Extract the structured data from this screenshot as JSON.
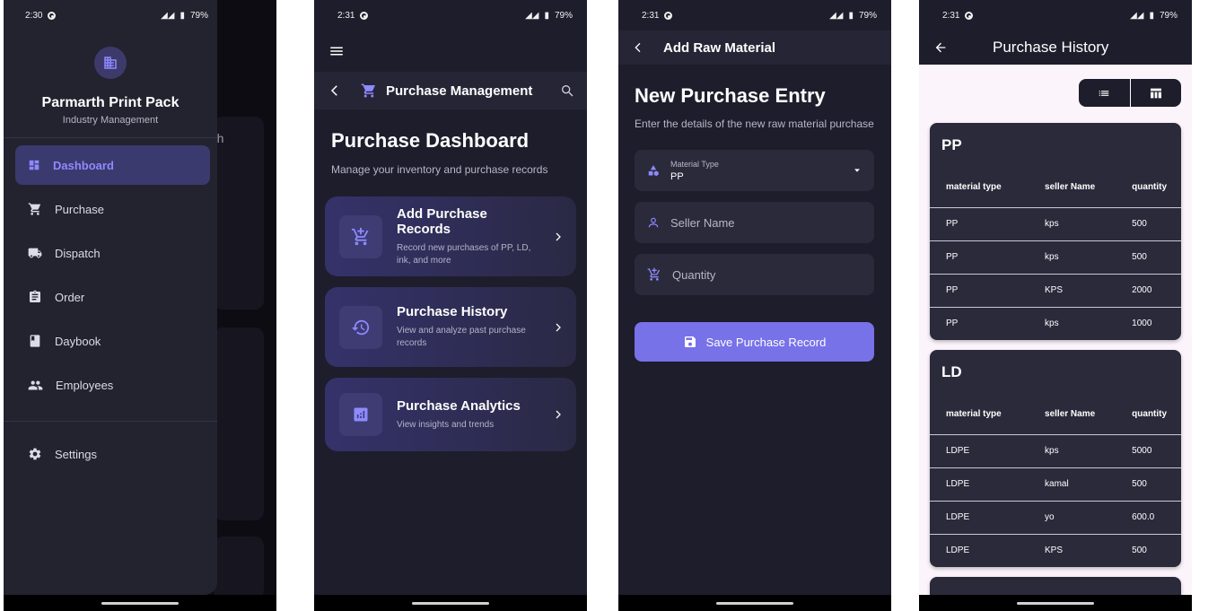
{
  "colors": {
    "bg": "#1e1d2b",
    "accent": "#7772e8",
    "accent_text": "#8e8aff",
    "table_page": "#fcf4fb"
  },
  "screen1": {
    "status": {
      "time": "2:30",
      "battery": "79%"
    },
    "bg_partial_text": "nth",
    "drawer": {
      "icon": "building-icon",
      "title": "Parmarth Print Pack",
      "subtitle": "Industry Management",
      "items": [
        {
          "label": "Dashboard",
          "icon": "dashboard-icon",
          "active": true
        },
        {
          "label": "Purchase",
          "icon": "cart-icon"
        },
        {
          "label": "Dispatch",
          "icon": "truck-icon"
        },
        {
          "label": "Order",
          "icon": "clipboard-icon"
        },
        {
          "label": "Daybook",
          "icon": "book-icon"
        },
        {
          "label": "Employees",
          "icon": "people-icon"
        }
      ],
      "settings": {
        "label": "Settings",
        "icon": "gear-icon"
      }
    }
  },
  "screen2": {
    "status": {
      "time": "2:31",
      "battery": "79%"
    },
    "toolbar_title": "Purchase Management",
    "heading": "Purchase Dashboard",
    "description": "Manage your inventory and purchase records",
    "cards": [
      {
        "title": "Add Purchase Records",
        "desc": "Record new purchases of PP, LD, ink, and more",
        "icon": "cart-add-icon"
      },
      {
        "title": "Purchase History",
        "desc": "View and analyze past purchase records",
        "icon": "history-icon"
      },
      {
        "title": "Purchase Analytics",
        "desc": "View insights and trends",
        "icon": "analytics-icon"
      }
    ]
  },
  "screen3": {
    "status": {
      "time": "2:31",
      "battery": "79%"
    },
    "appbar_title": "Add Raw Material",
    "heading": "New Purchase Entry",
    "description": "Enter the details of the new raw material purchase",
    "material": {
      "label": "Material Type",
      "value": "PP"
    },
    "seller_placeholder": "Seller Name",
    "quantity_placeholder": "Quantity",
    "save_label": "Save Purchase Record"
  },
  "screen4": {
    "status": {
      "time": "2:31",
      "battery": "79%"
    },
    "appbar_title": "Purchase History",
    "columns": [
      "material type",
      "seller Name",
      "quantity"
    ],
    "groups": [
      {
        "name": "PP",
        "rows": [
          [
            "PP",
            "kps",
            "500"
          ],
          [
            "PP",
            "kps",
            "500"
          ],
          [
            "PP",
            "KPS",
            "2000"
          ],
          [
            "PP",
            "kps",
            "1000"
          ]
        ]
      },
      {
        "name": "LD",
        "rows": [
          [
            "LDPE",
            "kps",
            "5000"
          ],
          [
            "LDPE",
            "kamal",
            "500"
          ],
          [
            "LDPE",
            "yo",
            "600.0"
          ],
          [
            "LDPE",
            "KPS",
            "500"
          ]
        ]
      }
    ]
  }
}
